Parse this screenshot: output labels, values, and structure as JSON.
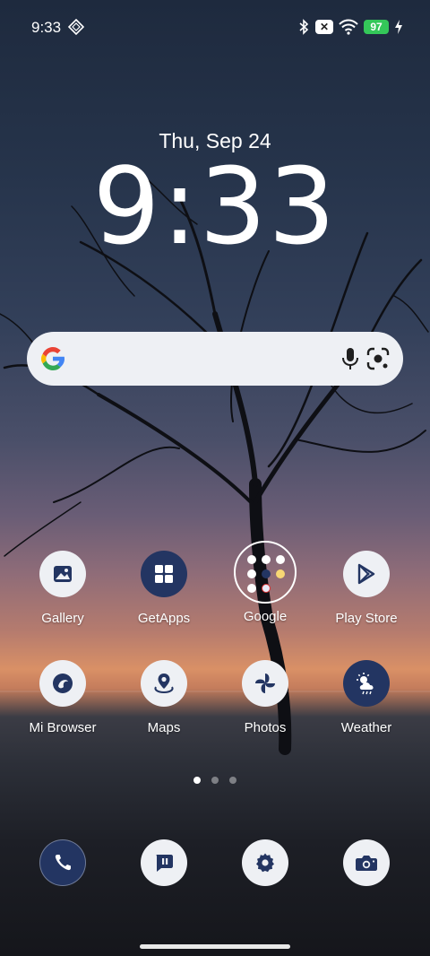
{
  "status_bar": {
    "time": "9:33",
    "battery": "97",
    "icons": [
      "diamond-icon",
      "bluetooth-icon",
      "x-badge-icon",
      "wifi-icon",
      "charging-icon"
    ]
  },
  "lockclock": {
    "date": "Thu, Sep 24",
    "time": "9:33"
  },
  "search_bar": {
    "logo": "google-g-icon",
    "icons": [
      "mic-icon",
      "lens-icon"
    ]
  },
  "apps_row1": [
    {
      "label": "Gallery",
      "icon": "gallery-icon"
    },
    {
      "label": "GetApps",
      "icon": "getapps-icon"
    },
    {
      "label": "Google",
      "icon": "folder-icon"
    },
    {
      "label": "Play Store",
      "icon": "play-store-icon"
    }
  ],
  "apps_row2": [
    {
      "label": "Mi Browser",
      "icon": "mi-browser-icon"
    },
    {
      "label": "Maps",
      "icon": "maps-icon"
    },
    {
      "label": "Photos",
      "icon": "photos-icon"
    },
    {
      "label": "Weather",
      "icon": "weather-icon"
    }
  ],
  "page_indicator": {
    "count": 3,
    "active": 1
  },
  "dock": [
    {
      "icon": "phone-icon"
    },
    {
      "icon": "messages-icon"
    },
    {
      "icon": "settings-icon"
    },
    {
      "icon": "camera-icon"
    }
  ],
  "colors": {
    "accent_dark": "#233562",
    "icon_light": "#eef0f4",
    "battery_green": "#34c759"
  }
}
